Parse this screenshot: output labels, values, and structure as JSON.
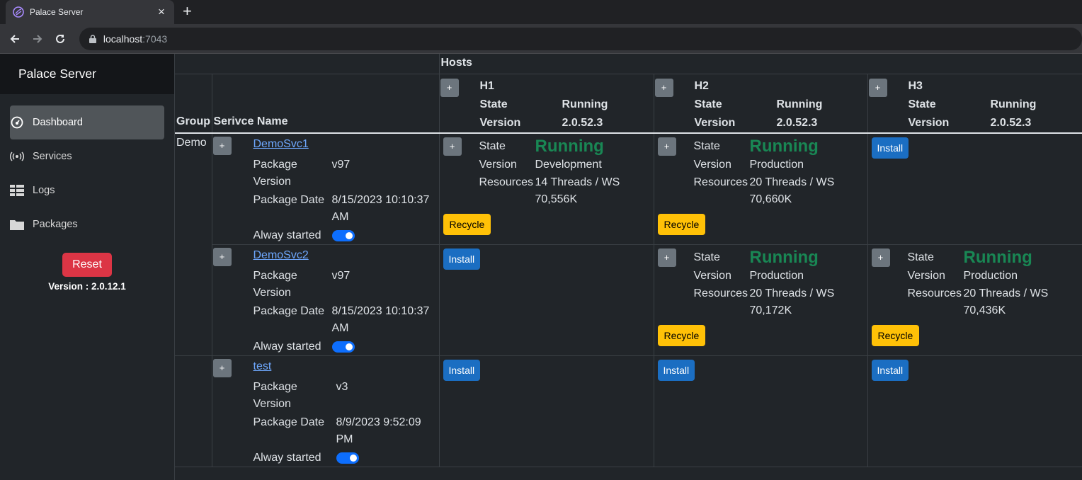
{
  "browser": {
    "tab_title": "Palace Server",
    "url_host": "localhost",
    "url_port": ":7043"
  },
  "sidebar": {
    "brand": "Palace Server",
    "items": [
      {
        "label": "Dashboard",
        "icon": "dashboard-icon",
        "active": true
      },
      {
        "label": "Services",
        "icon": "broadcast-icon"
      },
      {
        "label": "Logs",
        "icon": "list-icon"
      },
      {
        "label": "Packages",
        "icon": "folder-icon"
      }
    ],
    "reset_label": "Reset",
    "version_text": "Version : 2.0.12.1"
  },
  "table": {
    "hosts_label": "Hosts",
    "group_header": "Group",
    "service_header": "Serivce Name",
    "hosts": [
      {
        "name": "H1",
        "state_label": "State",
        "state": "Running",
        "version_label": "Version",
        "version": "2.0.52.3"
      },
      {
        "name": "H2",
        "state_label": "State",
        "state": "Running",
        "version_label": "Version",
        "version": "2.0.52.3"
      },
      {
        "name": "H3",
        "state_label": "State",
        "state": "Running",
        "version_label": "Version",
        "version": "2.0.52.3"
      }
    ],
    "group_name": "Demo",
    "services": [
      {
        "name": "DemoSvc1",
        "pkg_version_label": "Package Version",
        "pkg_version": "v97",
        "pkg_date_label": "Package Date",
        "pkg_date": "8/15/2023 10:10:37 AM",
        "always_label": "Alway started",
        "instances": [
          {
            "state_label": "State",
            "state": "Running",
            "version_label": "Version",
            "version": "Development",
            "resources_label": "Resources",
            "resources": "14 Threads / WS 70,556K",
            "action": "Recycle"
          },
          {
            "state_label": "State",
            "state": "Running",
            "version_label": "Version",
            "version": "Production",
            "resources_label": "Resources",
            "resources": "20 Threads / WS 70,660K",
            "action": "Recycle"
          },
          {
            "action": "Install"
          }
        ]
      },
      {
        "name": "DemoSvc2",
        "pkg_version_label": "Package Version",
        "pkg_version": "v97",
        "pkg_date_label": "Package Date",
        "pkg_date": "8/15/2023 10:10:37 AM",
        "always_label": "Alway started",
        "instances": [
          {
            "action": "Install"
          },
          {
            "state_label": "State",
            "state": "Running",
            "version_label": "Version",
            "version": "Production",
            "resources_label": "Resources",
            "resources": "20 Threads / WS 70,172K",
            "action": "Recycle"
          },
          {
            "state_label": "State",
            "state": "Running",
            "version_label": "Version",
            "version": "Production",
            "resources_label": "Resources",
            "resources": "20 Threads / WS 70,436K",
            "action": "Recycle"
          }
        ]
      },
      {
        "name": "test",
        "pkg_version_label": "Package Version",
        "pkg_version": "v3",
        "pkg_date_label": "Package Date",
        "pkg_date": "8/9/2023 9:52:09 PM",
        "always_label": "Alway started",
        "instances": [
          {
            "action": "Install"
          },
          {
            "action": "Install"
          },
          {
            "action": "Install"
          }
        ]
      }
    ],
    "plus_label": "+"
  },
  "colors": {
    "running": "#198754",
    "recycle": "#ffc107",
    "install": "#1b6ec2",
    "reset": "#dc3545"
  }
}
